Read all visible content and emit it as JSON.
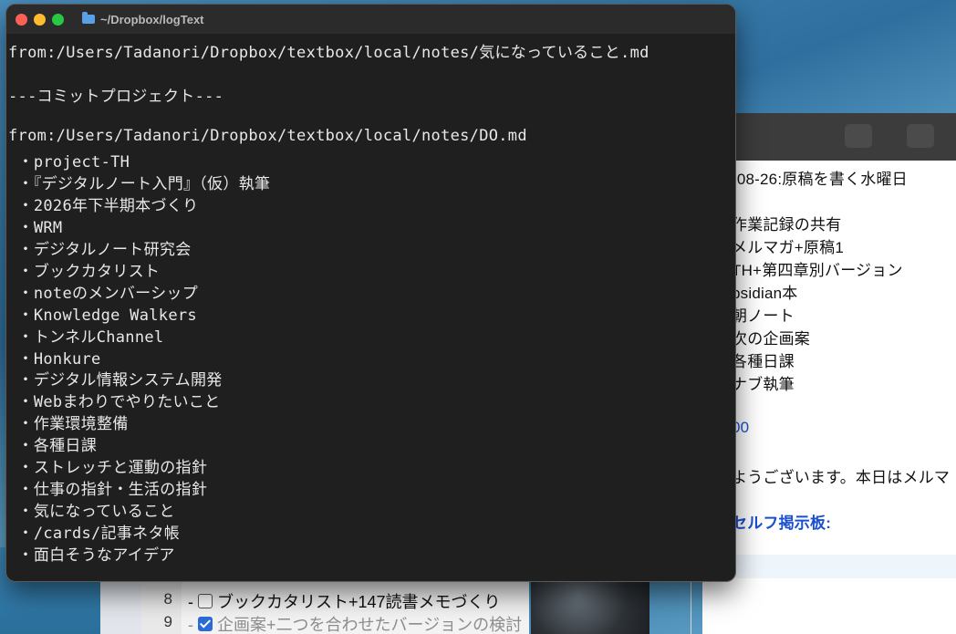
{
  "terminal": {
    "window_title": "~/Dropbox/logText",
    "lines": [
      "from:/Users/Tadanori/Dropbox/textbox/local/notes/気になっていること.md",
      "",
      "---コミットプロジェクト---",
      "",
      "from:/Users/Tadanori/Dropbox/textbox/local/notes/DO.md",
      " ・project-TH",
      " ・『デジタルノート入門』（仮）執筆",
      " ・2026年下半期本づくり",
      " ・WRM",
      " ・デジタルノート研究会",
      " ・ブックカタリスト",
      " ・noteのメンバーシップ",
      " ・Knowledge Walkers",
      " ・トンネルChannel",
      " ・Honkure",
      " ・デジタル情報システム開発",
      " ・Webまわりでやりたいこと",
      " ・作業環境整備",
      " ・各種日課",
      " ・ストレッチと運動の指針",
      " ・仕事の指針・生活の指針",
      " ・気になっていること",
      " ・/cards/記事ネタ帳",
      " ・面白そうなアイデア"
    ]
  },
  "background_window": {
    "lines": [
      {
        "text": "-08-26:原稿を書く水曜日",
        "style": "normal"
      },
      {
        "text": "作業記録の共有",
        "style": "normal"
      },
      {
        "text": "メルマガ+原稿1",
        "style": "normal"
      },
      {
        "text": "TH+第四章別バージョン",
        "style": "normal"
      },
      {
        "text": "bsidian本",
        "style": "normal"
      },
      {
        "text": "朝ノート",
        "style": "normal"
      },
      {
        "text": "次の企画案",
        "style": "normal"
      },
      {
        "text": "各種日課",
        "style": "normal"
      },
      {
        "text": "ナブ執筆",
        "style": "normal"
      },
      {
        "text": "00",
        "style": "blue"
      },
      {
        "text": "ようございます。本日はメルマ",
        "style": "normal"
      },
      {
        "text": "セルフ掲示板:",
        "style": "blue-bold"
      }
    ]
  },
  "background_editor": {
    "lines": [
      {
        "number": "8",
        "text": "- ブックカタリスト+147読書メモづくり",
        "checked": false
      },
      {
        "number": "9",
        "text": "- 企画案+二つを合わせたバージョンの検討",
        "checked": true
      }
    ]
  },
  "colors": {
    "terminal_bg": "#1f1f1f",
    "terminal_text": "#e8e8e8",
    "link_blue": "#1a4fd0"
  }
}
